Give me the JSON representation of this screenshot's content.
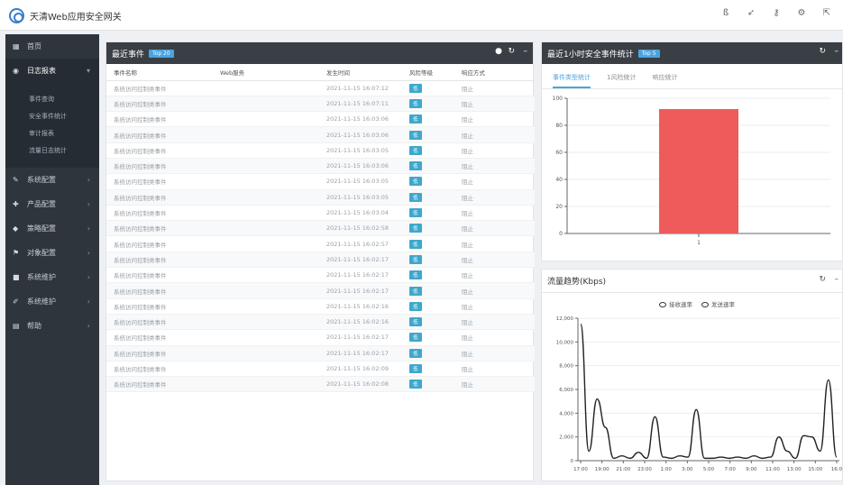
{
  "app": {
    "title": "天清Web应用安全网关"
  },
  "topbar_icons": [
    "bell-icon",
    "pin-icon",
    "key-icon",
    "gear-icon",
    "logout-icon"
  ],
  "sidebar": {
    "items": [
      {
        "label": "首页",
        "icon": "grid-icon",
        "arrow": ""
      },
      {
        "label": "日志报表",
        "icon": "location-icon",
        "arrow": "▾",
        "open": true
      },
      {
        "label": "系统配置",
        "icon": "wrench-icon",
        "arrow": "›"
      },
      {
        "label": "产品配置",
        "icon": "tag-icon",
        "arrow": "›"
      },
      {
        "label": "策略配置",
        "icon": "shield-icon",
        "arrow": "›"
      },
      {
        "label": "对象配置",
        "icon": "flag-icon",
        "arrow": "›"
      },
      {
        "label": "系统维护",
        "icon": "box-icon",
        "arrow": "›"
      },
      {
        "label": "系统维护",
        "icon": "wrench-icon",
        "arrow": "›"
      },
      {
        "label": "帮助",
        "icon": "doc-icon",
        "arrow": "›"
      }
    ],
    "subitems": [
      "事件查询",
      "安全事件统计",
      "审计报表",
      "流量日志统计"
    ]
  },
  "events_panel": {
    "title": "最近事件",
    "badge": "Top 20",
    "columns": [
      "事件名称",
      "Web服务",
      "发生时间",
      "风险等级",
      "响应方式"
    ],
    "rows": [
      [
        "系统访问控制类事件",
        "",
        "2021-11-15 16:07:12",
        "低",
        "阻止"
      ],
      [
        "系统访问控制类事件",
        "",
        "2021-11-15 16:07:11",
        "低",
        "阻止"
      ],
      [
        "系统访问控制类事件",
        "",
        "2021-11-15 16:03:06",
        "低",
        "阻止"
      ],
      [
        "系统访问控制类事件",
        "",
        "2021-11-15 16:03:06",
        "低",
        "阻止"
      ],
      [
        "系统访问控制类事件",
        "",
        "2021-11-15 16:03:05",
        "低",
        "阻止"
      ],
      [
        "系统访问控制类事件",
        "",
        "2021-11-15 16:03:06",
        "低",
        "阻止"
      ],
      [
        "系统访问控制类事件",
        "",
        "2021-11-15 16:03:05",
        "低",
        "阻止"
      ],
      [
        "系统访问控制类事件",
        "",
        "2021-11-15 16:03:05",
        "低",
        "阻止"
      ],
      [
        "系统访问控制类事件",
        "",
        "2021-11-15 16:03:04",
        "低",
        "阻止"
      ],
      [
        "系统访问控制类事件",
        "",
        "2021-11-15 16:02:58",
        "低",
        "阻止"
      ],
      [
        "系统访问控制类事件",
        "",
        "2021-11-15 16:02:57",
        "低",
        "阻止"
      ],
      [
        "系统访问控制类事件",
        "",
        "2021-11-15 16:02:17",
        "低",
        "阻止"
      ],
      [
        "系统访问控制类事件",
        "",
        "2021-11-15 16:02:17",
        "低",
        "阻止"
      ],
      [
        "系统访问控制类事件",
        "",
        "2021-11-15 16:02:17",
        "低",
        "阻止"
      ],
      [
        "系统访问控制类事件",
        "",
        "2021-11-15 16:02:16",
        "低",
        "阻止"
      ],
      [
        "系统访问控制类事件",
        "",
        "2021-11-15 16:02:16",
        "低",
        "阻止"
      ],
      [
        "系统访问控制类事件",
        "",
        "2021-11-15 16:02:17",
        "低",
        "阻止"
      ],
      [
        "系统访问控制类事件",
        "",
        "2021-11-15 16:02:17",
        "低",
        "阻止"
      ],
      [
        "系统访问控制类事件",
        "",
        "2021-11-15 16:02:09",
        "低",
        "阻止"
      ],
      [
        "系统访问控制类事件",
        "",
        "2021-11-15 16:02:08",
        "低",
        "阻止"
      ]
    ]
  },
  "stats_panel": {
    "title": "最近1小时安全事件统计",
    "badge": "Top 5",
    "tabs": [
      "事件类型统计",
      "1风险统计",
      "响应统计"
    ]
  },
  "traffic_panel": {
    "title": "流量趋势(Kbps)",
    "legend": [
      "接收速率",
      "发送速率"
    ]
  },
  "chart_data": [
    {
      "type": "bar",
      "categories": [
        "1"
      ],
      "values": [
        92
      ],
      "ylim": [
        0,
        100
      ],
      "yticks": [
        "0",
        "20",
        "40",
        "60",
        "80",
        "100"
      ],
      "color": "#ef5b5b"
    },
    {
      "type": "line",
      "title": "流量趋势(Kbps)",
      "x": [
        "17:00",
        "19:00",
        "21:00",
        "23:00",
        "1:00",
        "3:00",
        "5:00",
        "7:00",
        "9:00",
        "11:00",
        "13:00",
        "15:00",
        "16:0"
      ],
      "ylim": [
        0,
        12000
      ],
      "yticks": [
        "0",
        "2,000",
        "4,000",
        "6,000",
        "8,000",
        "10,000",
        "12,000"
      ],
      "series": [
        {
          "name": "接收速率",
          "values": [
            11500,
            800,
            5200,
            2800,
            200,
            400,
            200,
            700,
            200,
            3700,
            300,
            200,
            400,
            300,
            4300,
            200,
            200,
            300,
            200,
            300,
            200,
            400,
            200,
            300,
            2000,
            800,
            200,
            2100,
            2000,
            800,
            6800,
            300
          ]
        }
      ]
    }
  ]
}
